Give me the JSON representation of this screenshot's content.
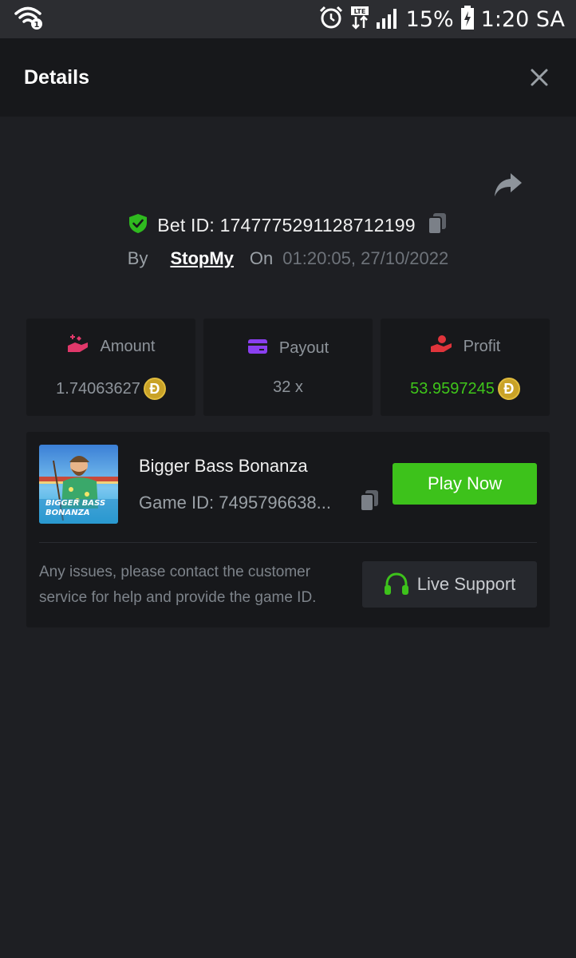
{
  "status_bar": {
    "battery_text": "15%",
    "time_text": "1:20 SA",
    "network_label": "LTE"
  },
  "header": {
    "title": "Details"
  },
  "bet": {
    "id_text": "Bet ID: 1747775291128712199",
    "by_label": "By",
    "user": "StopMy",
    "on_label": "On",
    "date": "01:20:05, 27/10/2022"
  },
  "stats": {
    "amount": {
      "label": "Amount",
      "value": "1.74063627",
      "icon": "hand-bet-icon",
      "coin": "Ð"
    },
    "payout": {
      "label": "Payout",
      "value": "32 x",
      "icon": "card-icon"
    },
    "profit": {
      "label": "Profit",
      "value": "53.9597245",
      "icon": "hand-profit-icon",
      "coin": "Ð"
    }
  },
  "game": {
    "name": "Bigger Bass Bonanza",
    "id_text": "Game ID: 7495796638...",
    "thumb_title_line1": "BIGGER BASS",
    "thumb_title_line2": "BONANZA",
    "play_label": "Play Now"
  },
  "support": {
    "note": "Any issues, please contact the customer service for help and provide the game ID.",
    "button_label": "Live Support"
  },
  "colors": {
    "accent_green": "#3dc21b",
    "profit_green": "#3fc51a",
    "background": "#1e1f23",
    "panel": "#17181b"
  }
}
